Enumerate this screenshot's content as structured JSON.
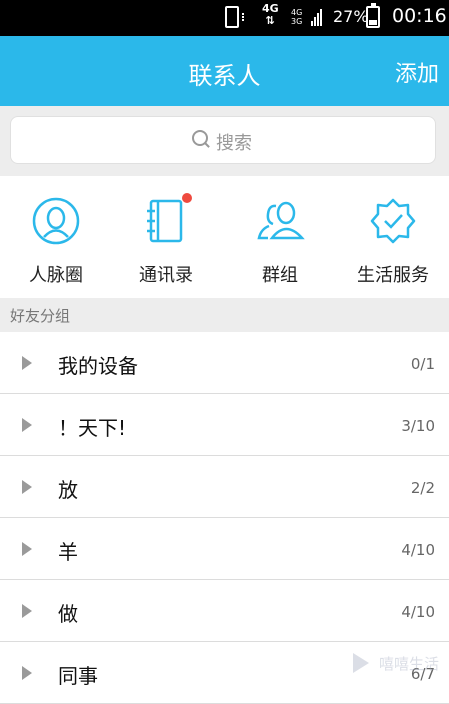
{
  "status_bar": {
    "network": "4G",
    "signal_top": "4G",
    "signal_bottom": "3G",
    "battery_percent": "27%",
    "time": "00:16"
  },
  "header": {
    "title": "联系人",
    "add_label": "添加"
  },
  "search": {
    "placeholder": "搜索"
  },
  "features": [
    {
      "label": "人脉圈",
      "icon": "contacts-circle-icon"
    },
    {
      "label": "通讯录",
      "icon": "address-book-icon",
      "badge": true
    },
    {
      "label": "群组",
      "icon": "group-icon"
    },
    {
      "label": "生活服务",
      "icon": "life-service-icon"
    }
  ],
  "section": {
    "title": "好友分组"
  },
  "groups": [
    {
      "name": "我的设备",
      "count": "0/1"
    },
    {
      "name": "！天下!",
      "count": "3/10"
    },
    {
      "name": "放",
      "count": "2/2"
    },
    {
      "name": "羊",
      "count": "4/10"
    },
    {
      "name": "做",
      "count": "4/10"
    },
    {
      "name": "同事",
      "count": "6/7"
    }
  ],
  "watermark": {
    "text": "嘻嘻生活"
  },
  "colors": {
    "accent": "#2bb8ea",
    "badge": "#ef4a3f",
    "status_bar": "#000000",
    "background_gray": "#ededed"
  }
}
